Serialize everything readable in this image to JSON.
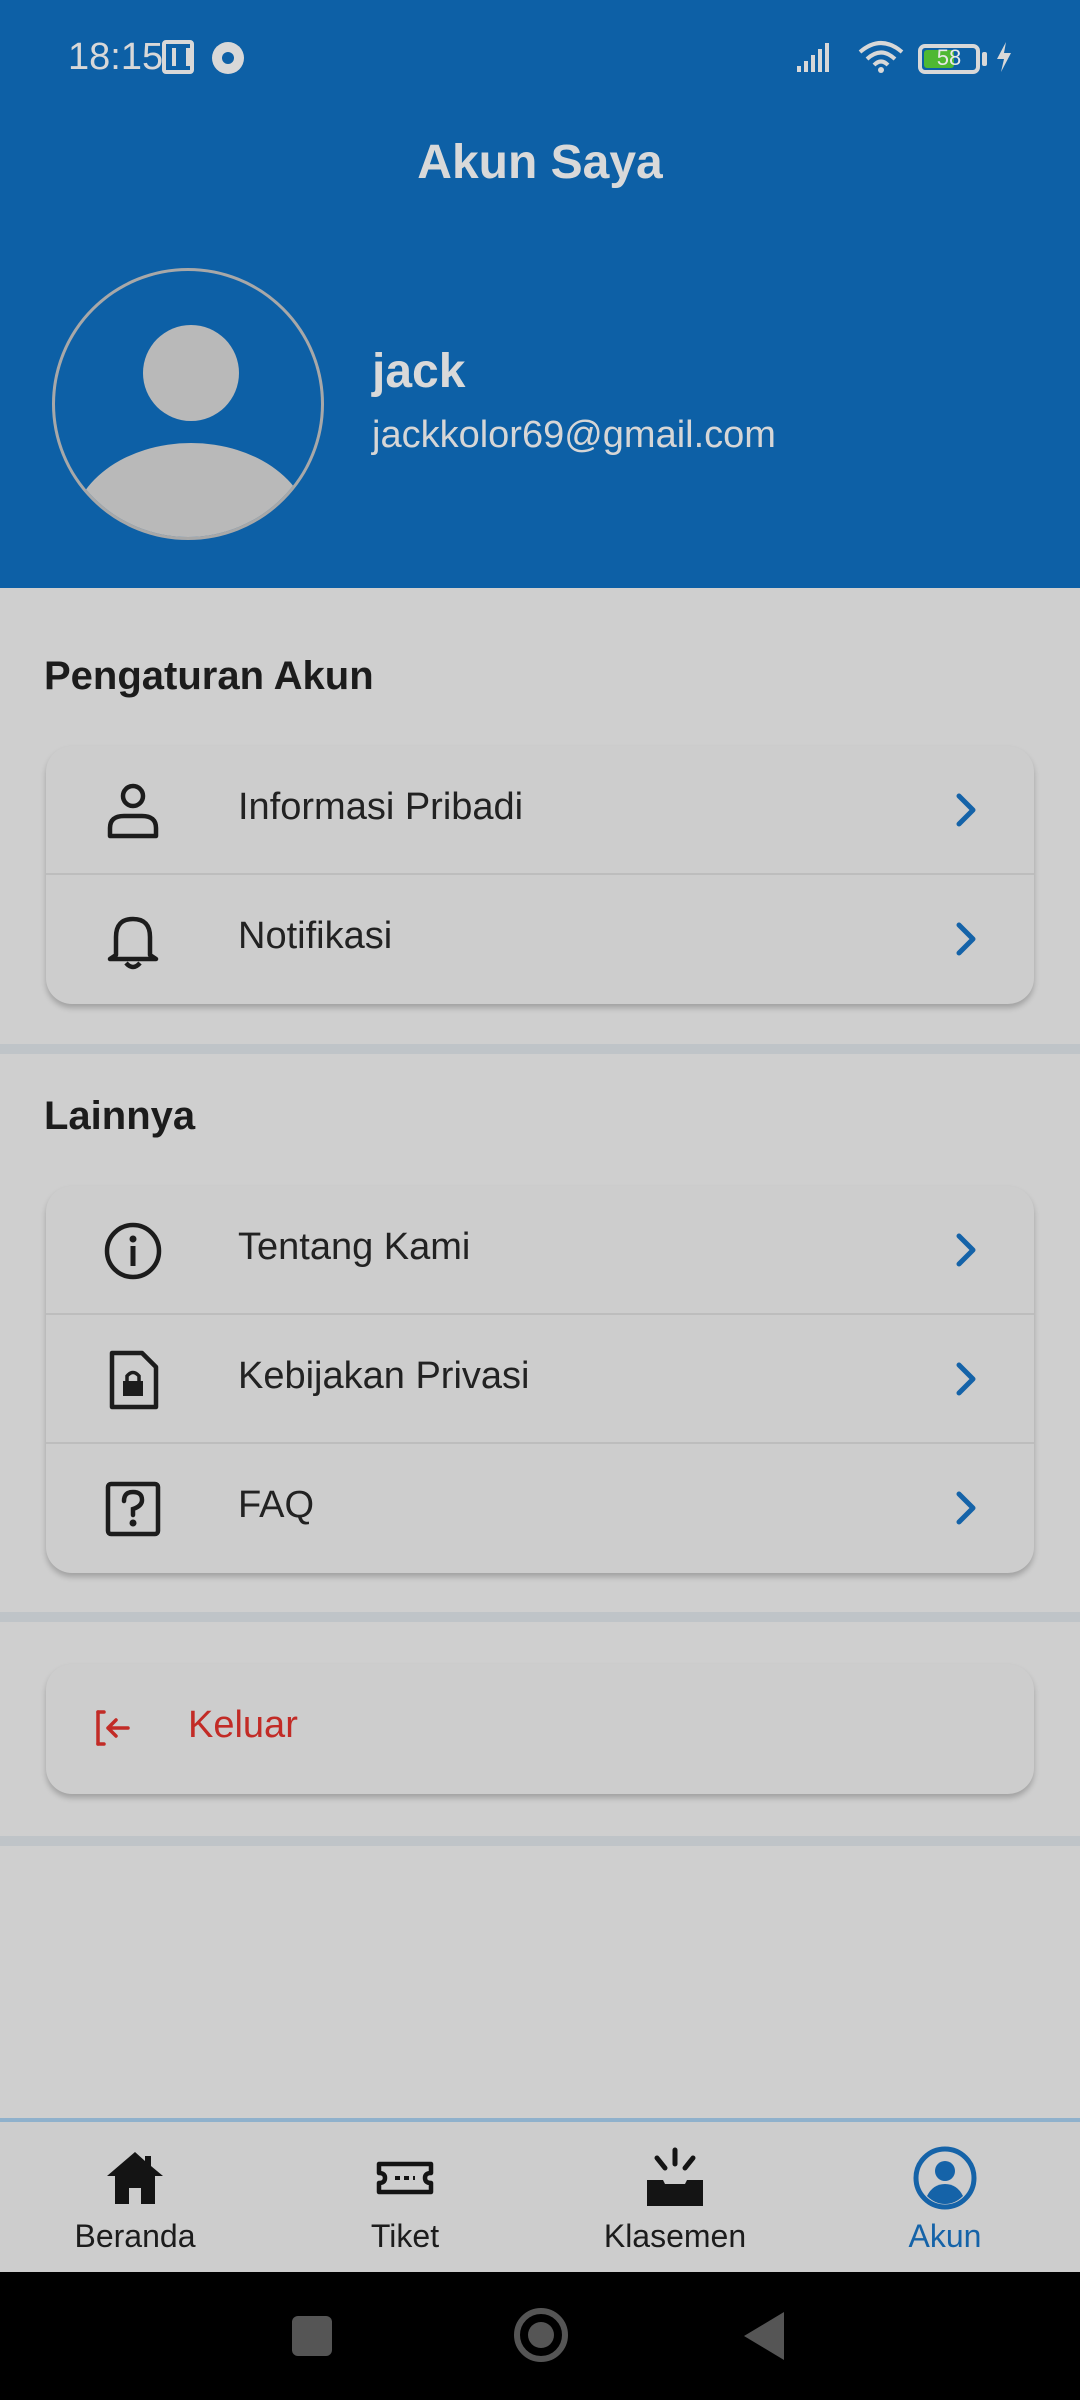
{
  "status_bar": {
    "time": "18:15",
    "battery_level": "58"
  },
  "header": {
    "title": "Akun Saya"
  },
  "profile": {
    "name": "jack",
    "email": "jackkolor69@gmail.com"
  },
  "sections": {
    "account": {
      "title": "Pengaturan Akun",
      "items": [
        {
          "label": "Informasi Pribadi",
          "icon": "person-icon"
        },
        {
          "label": "Notifikasi",
          "icon": "bell-icon"
        }
      ]
    },
    "other": {
      "title": "Lainnya",
      "items": [
        {
          "label": "Tentang Kami",
          "icon": "info-icon"
        },
        {
          "label": "Kebijakan Privasi",
          "icon": "document-lock-icon"
        },
        {
          "label": "FAQ",
          "icon": "question-icon"
        }
      ]
    }
  },
  "logout": {
    "label": "Keluar"
  },
  "bottom_nav": {
    "items": [
      {
        "label": "Beranda",
        "icon": "home-icon"
      },
      {
        "label": "Tiket",
        "icon": "ticket-icon"
      },
      {
        "label": "Klasemen",
        "icon": "podium-icon"
      },
      {
        "label": "Akun",
        "icon": "account-icon",
        "active": true
      }
    ]
  },
  "colors": {
    "brand_blue": "#0d60a6",
    "accent_blue": "#1563a8",
    "danger_red": "#c22b26"
  }
}
